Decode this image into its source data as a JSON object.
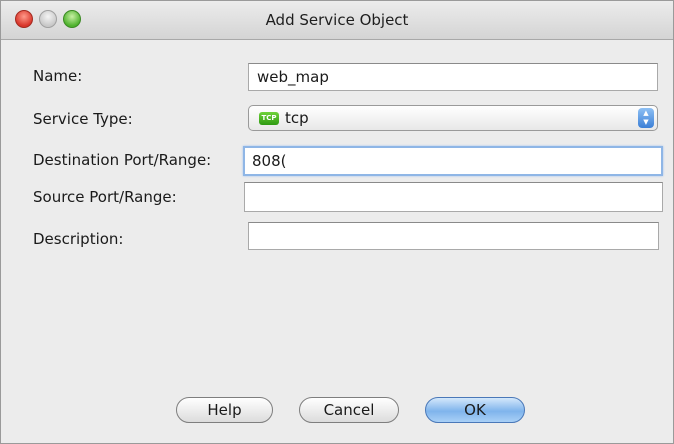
{
  "window": {
    "title": "Add Service Object"
  },
  "form": {
    "name_label": "Name:",
    "name_value": "web_map",
    "service_type_label": "Service Type:",
    "service_type_icon_text": "TCP",
    "service_type_value": "tcp",
    "dest_port_label": "Destination Port/Range:",
    "dest_port_value": "808(",
    "source_port_label": "Source Port/Range:",
    "source_port_value": "",
    "description_label": "Description:",
    "description_value": ""
  },
  "buttons": {
    "help": "Help",
    "cancel": "Cancel",
    "ok": "OK"
  }
}
